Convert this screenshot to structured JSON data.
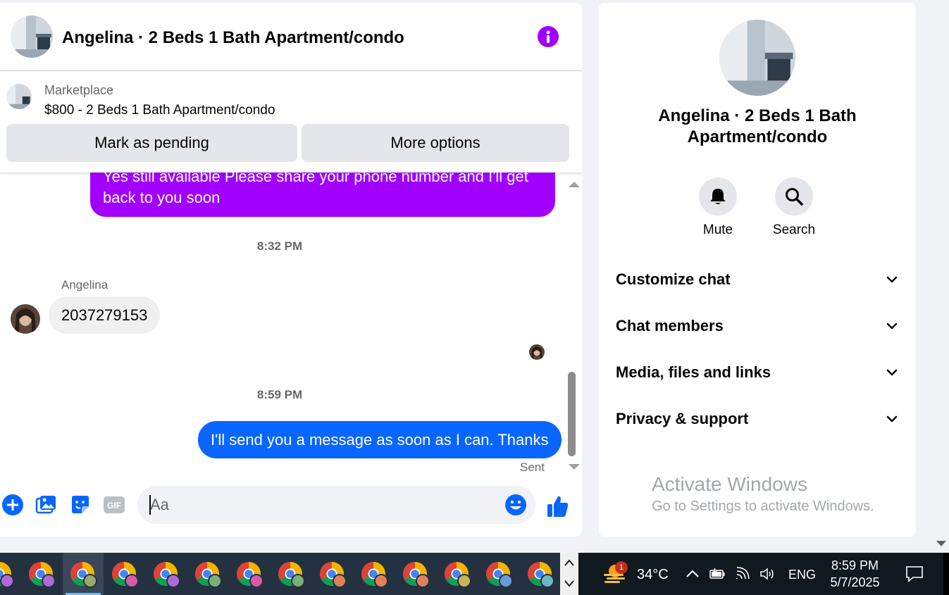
{
  "chat": {
    "title": "Angelina · 2 Beds 1 Bath Apartment/condo",
    "listing": {
      "source": "Marketplace",
      "title": "$800 - 2 Beds 1 Bath Apartment/condo",
      "mark_pending_label": "Mark as pending",
      "more_options_label": "More options"
    },
    "messages": {
      "out_1": "Yes still available Please share your phone number and I'll get back to you soon",
      "timestamp_1": "8:32 PM",
      "sender_name": "Angelina",
      "in_1": "2037279153",
      "timestamp_2": "8:59 PM",
      "out_2": "I'll send you a message as soon as I can. Thanks",
      "sent_status": "Sent"
    },
    "composer": {
      "placeholder": "Aa",
      "gif_label": "GIF"
    },
    "colors": {
      "accent_purple": "#a100ff",
      "messenger_blue": "#0866ff"
    }
  },
  "info_panel": {
    "title": "Angelina · 2 Beds 1 Bath Apartment/condo",
    "actions": [
      {
        "label": "Mute",
        "icon": "bell-icon"
      },
      {
        "label": "Search",
        "icon": "search-icon"
      }
    ],
    "sections": [
      {
        "label": "Customize chat"
      },
      {
        "label": "Chat members"
      },
      {
        "label": "Media, files and links"
      },
      {
        "label": "Privacy & support"
      }
    ],
    "watermark": {
      "title": "Activate Windows",
      "subtitle": "Go to Settings to activate Windows."
    }
  },
  "taskbar": {
    "weather_badge": "1",
    "temperature": "34°C",
    "language": "ENG",
    "time": "8:59 PM",
    "date": "5/7/2025",
    "app_profile_colors": [
      "#b069d8",
      "#b069d8",
      "#9aa86a",
      "#d85aa8",
      "#b069d8",
      "#7aae7a",
      "#d85aa8",
      "#7aae7a",
      "#e0805a",
      "#e0805a",
      "#e0805a",
      "#c8b45a",
      "#6a9ad8",
      "#6ab8c8"
    ]
  }
}
